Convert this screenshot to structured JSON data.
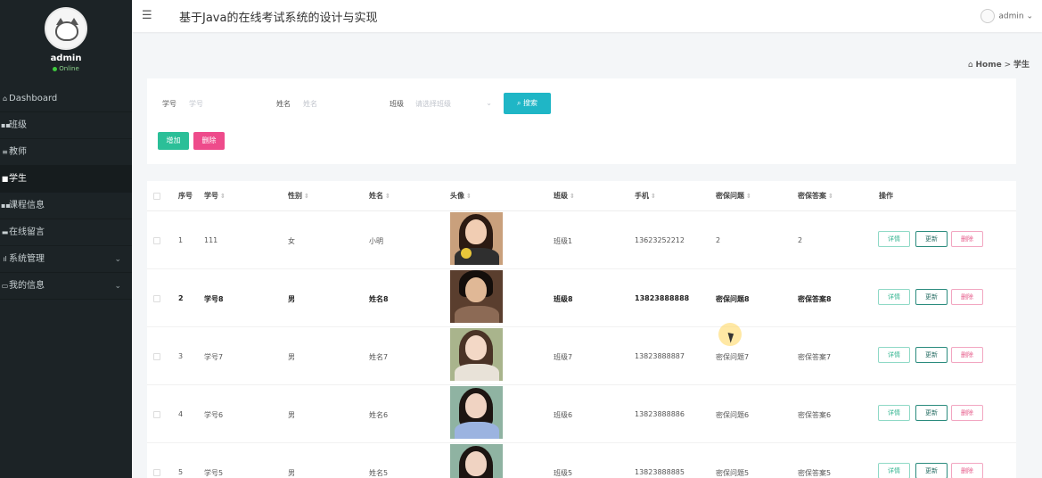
{
  "sidebar": {
    "username": "admin",
    "status": "Online",
    "items": [
      {
        "icon": "⌂",
        "label": "Dashboard"
      },
      {
        "icon": "▪▪",
        "label": "班级"
      },
      {
        "icon": "≡",
        "label": "教师"
      },
      {
        "icon": "■",
        "label": "学生"
      },
      {
        "icon": "▪▪",
        "label": "课程信息"
      },
      {
        "icon": "▬",
        "label": "在线留言"
      },
      {
        "icon": "ıl",
        "label": "系统管理"
      },
      {
        "icon": "▭",
        "label": "我的信息"
      }
    ]
  },
  "header": {
    "title": "基于Java的在线考试系统的设计与实现",
    "user": "admin"
  },
  "breadcrumb": {
    "home": "Home",
    "sep": ">",
    "current": "学生"
  },
  "search": {
    "id_label": "学号",
    "id_placeholder": "学号",
    "name_label": "姓名",
    "name_placeholder": "姓名",
    "class_label": "班级",
    "class_placeholder": "请选择班级",
    "search_button": "搜索",
    "add_button": "增加",
    "delete_button": "删除"
  },
  "table": {
    "headers": [
      "序号",
      "学号",
      "性别",
      "姓名",
      "头像",
      "班级",
      "手机",
      "密保问题",
      "密保答案",
      "操作"
    ],
    "actions": {
      "detail": "详情",
      "update": "更新",
      "delete": "删除"
    },
    "rows": [
      {
        "no": "1",
        "sid": "111",
        "gender": "女",
        "name": "小明",
        "class": "班级1",
        "phone": "13623252212",
        "q": "2",
        "a": "2"
      },
      {
        "no": "2",
        "sid": "学号8",
        "gender": "男",
        "name": "姓名8",
        "class": "班级8",
        "phone": "13823888888",
        "q": "密保问题8",
        "a": "密保答案8"
      },
      {
        "no": "3",
        "sid": "学号7",
        "gender": "男",
        "name": "姓名7",
        "class": "班级7",
        "phone": "13823888887",
        "q": "密保问题7",
        "a": "密保答案7"
      },
      {
        "no": "4",
        "sid": "学号6",
        "gender": "男",
        "name": "姓名6",
        "class": "班级6",
        "phone": "13823888886",
        "q": "密保问题6",
        "a": "密保答案6"
      },
      {
        "no": "5",
        "sid": "学号5",
        "gender": "男",
        "name": "姓名5",
        "class": "班级5",
        "phone": "13823888885",
        "q": "密保问题5",
        "a": "密保答案5"
      }
    ]
  }
}
